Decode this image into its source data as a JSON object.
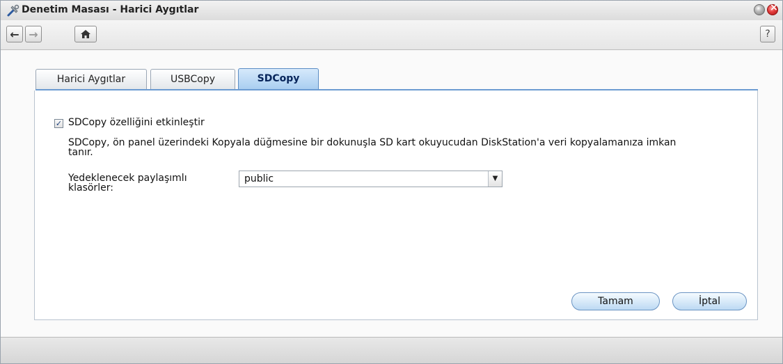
{
  "window": {
    "title": "Denetim Masası - Harici Aygıtlar"
  },
  "toolbar": {
    "back_icon": "arrow-left-icon",
    "forward_icon": "arrow-right-icon",
    "home_icon": "home-icon",
    "help_label": "?"
  },
  "tabs": [
    {
      "label": "Harici Aygıtlar",
      "active": false
    },
    {
      "label": "USBCopy",
      "active": false
    },
    {
      "label": "SDCopy",
      "active": true
    }
  ],
  "sdcopy": {
    "enable_label": "SDCopy özelliğini etkinleştir",
    "enable_checked": true,
    "description": "SDCopy, ön panel üzerindeki Kopyala düğmesine bir dokunuşla SD kart okuyucudan DiskStation'a veri kopyalamanıza imkan tanır.",
    "folder_label": "Yedeklenecek paylaşımlı klasörler:",
    "folder_value": "public"
  },
  "buttons": {
    "ok_label": "Tamam",
    "cancel_label": "İptal"
  },
  "colors": {
    "active_tab": "#a8cdf0",
    "button_border": "#6a93c2",
    "close_button": "#e23b3b"
  }
}
